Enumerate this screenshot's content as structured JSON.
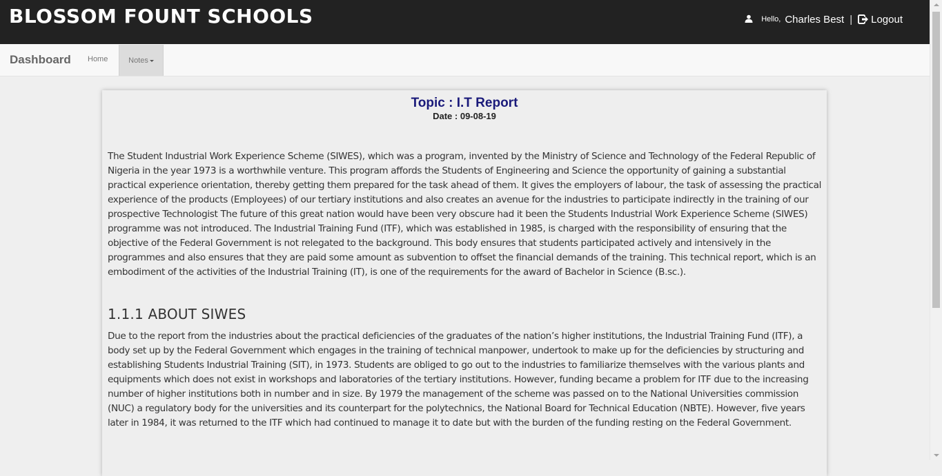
{
  "header": {
    "brand": "BLOSSOM FOUNT SCHOOLS",
    "greeting": "Hello,",
    "username": "Charles Best",
    "separator": "|",
    "logout_label": "Logout"
  },
  "navbar": {
    "brand": "Dashboard",
    "items": [
      {
        "label": "Home"
      },
      {
        "label": "Notes"
      }
    ]
  },
  "note": {
    "topic": "Topic : I.T Report",
    "date": "Date : 09-08-19",
    "paragraph1": " The Student Industrial Work Experience Scheme (SIWES), which was a program, invented by the Ministry of Science and Technology of the Federal Republic of Nigeria in the year 1973 is a worthwhile venture. This program affords the Students of Engineering and Science the opportunity of gaining a substantial practical experience orientation, thereby getting them prepared for the task ahead of them. It gives the employers of labour, the task of assessing the practical experience of the products (Employees) of our tertiary institutions and also creates an avenue for the industries to participate indirectly in the training of our prospective Technologist The future of this great nation would have been very obscure had it been the Students Industrial Work Experience Scheme (SIWES) programme was not introduced. The Industrial Training Fund (ITF), which was established in 1985, is charged with the responsibility of ensuring that the objective of the Federal Government is not relegated to the background. This body ensures that students participated actively and intensively in the programmes and also ensures that they are paid some amount as subvention to offset the financial demands of the training. This technical report, which is an embodiment of the activities of the Industrial Training (IT), is one of the requirements for the award of Bachelor in Science (B.sc.).",
    "section_heading": "1.1.1 ABOUT SIWES",
    "paragraph2": "Due to the report from the industries about the practical deficiencies of the graduates of the nation’s higher institutions, the Industrial Training Fund (ITF), a body set up by the Federal Government which engages in the training of technical manpower, undertook to make up for the deficiencies by structuring and establishing Students Industrial Training (SIT), in 1973. Students are obliged to go out to the industries to familiarize themselves with the various plants and equipments which does not exist in workshops and laboratories of the tertiary institutions. However, funding became a problem for ITF due to the increasing number of higher institutions both in number and in size. By 1979 the management of the scheme was passed on to the National Universities commission (NUC) a regulatory body for the universities and its counterpart for the polytechnics, the National Board for Technical Education (NBTE). However, five years later in 1984, it was returned to the ITF which had continued to manage it to date but with the burden of the funding resting on the Federal Government."
  },
  "icons": {
    "user": "user-icon",
    "logout": "logout-icon",
    "caret": "caret-down-icon"
  },
  "colors": {
    "topbar": "#222222",
    "topic": "#1a1a7a",
    "background": "#efefef"
  }
}
